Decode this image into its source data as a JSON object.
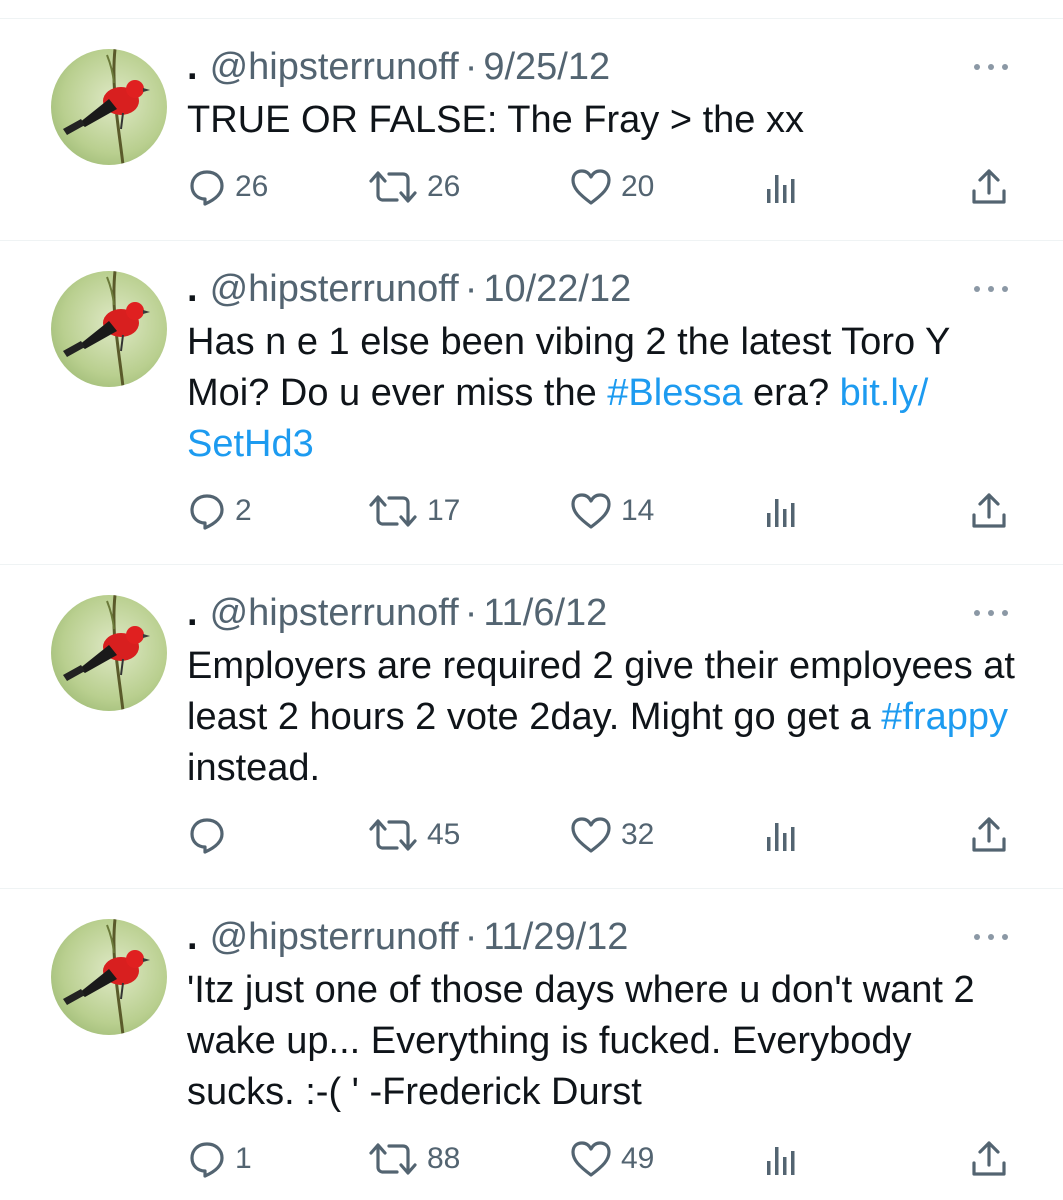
{
  "tweets": [
    {
      "name": ".",
      "handle": "@hipsterrunoff",
      "separator": "·",
      "date": "9/25/12",
      "text_segments": [
        {
          "text": "TRUE OR FALSE: The Fray > the xx",
          "type": "text"
        }
      ],
      "replies": "26",
      "retweets": "26",
      "likes": "20"
    },
    {
      "name": ".",
      "handle": "@hipsterrunoff",
      "separator": "·",
      "date": "10/22/12",
      "text_segments": [
        {
          "text": "Has n e 1 else been vibing 2 the latest Toro Y Moi? Do u ever miss the ",
          "type": "text"
        },
        {
          "text": "#Blessa",
          "type": "link"
        },
        {
          "text": " era? ",
          "type": "text"
        },
        {
          "text": "bit.ly/​SetHd3",
          "type": "link"
        }
      ],
      "replies": "2",
      "retweets": "17",
      "likes": "14"
    },
    {
      "name": ".",
      "handle": "@hipsterrunoff",
      "separator": "·",
      "date": "11/6/12",
      "text_segments": [
        {
          "text": "Employers are required 2 give their employees at least 2 hours 2 vote 2day. Might go get a ",
          "type": "text"
        },
        {
          "text": "#frappy",
          "type": "link"
        },
        {
          "text": " instead.",
          "type": "text"
        }
      ],
      "replies": "",
      "retweets": "45",
      "likes": "32"
    },
    {
      "name": ".",
      "handle": "@hipsterrunoff",
      "separator": "·",
      "date": "11/29/12",
      "text_segments": [
        {
          "text": "'Itz just one of those days where u don't want 2 wake up... Everything is fucked. Everybody sucks. :-( ' -Frederick Durst",
          "type": "text"
        }
      ],
      "replies": "1",
      "retweets": "88",
      "likes": "49"
    }
  ],
  "icons": {
    "more": "more-dots-icon",
    "reply": "reply-bubble-icon",
    "retweet": "retweet-arrows-icon",
    "like": "heart-icon",
    "views": "bar-chart-icon",
    "share": "share-upload-icon",
    "avatar": "red-bird-on-branch"
  },
  "colors": {
    "text": "#0f1419",
    "secondary": "#536471",
    "link": "#1d9bf0",
    "divider": "#eff3f4"
  }
}
